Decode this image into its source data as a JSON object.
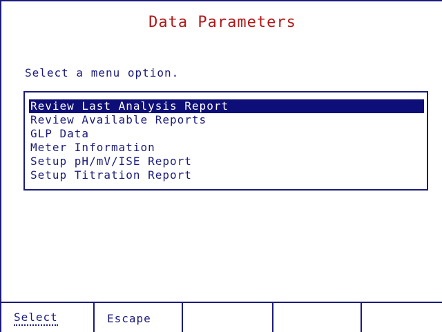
{
  "title": "Data Parameters",
  "prompt": "Select a menu option.",
  "menu": {
    "items": [
      {
        "label": "Review Last Analysis Report",
        "selected": true
      },
      {
        "label": "Review Available Reports",
        "selected": false
      },
      {
        "label": "GLP Data",
        "selected": false
      },
      {
        "label": "Meter Information",
        "selected": false
      },
      {
        "label": "Setup pH/mV/ISE Report",
        "selected": false
      },
      {
        "label": "Setup Titration Report",
        "selected": false
      }
    ]
  },
  "softkeys": [
    {
      "label": "Select"
    },
    {
      "label": "Escape"
    },
    {
      "label": ""
    },
    {
      "label": ""
    },
    {
      "label": ""
    }
  ],
  "colors": {
    "title": "#b01818",
    "text": "#1a1a7a",
    "highlight": "#0e0e78"
  }
}
